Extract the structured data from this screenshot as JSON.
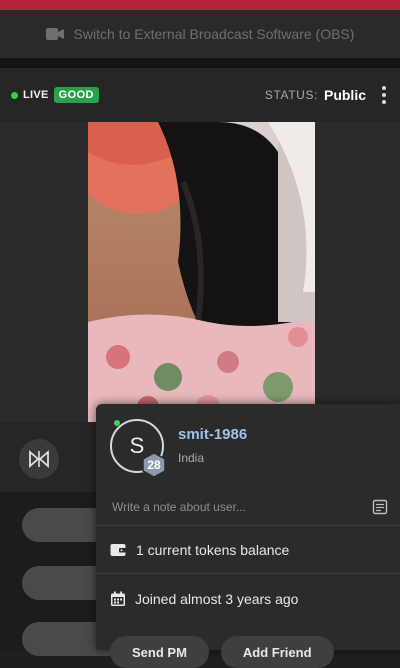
{
  "obs_bar": {
    "label": "Switch to External Broadcast Software (OBS)",
    "icon": "video-camera-icon"
  },
  "status_bar": {
    "live_label": "LIVE",
    "quality_badge": "GOOD",
    "status_label": "STATUS:",
    "status_value": "Public",
    "menu_icon": "kebab-menu-icon"
  },
  "controls": {
    "split_icon": "split-view-icon"
  },
  "user_card": {
    "avatar_initial": "S",
    "level": "28",
    "username": "smit-1986",
    "country": "India",
    "note_placeholder": "Write a note about user...",
    "note_icon": "note-icon",
    "tokens_text": "1 current tokens balance",
    "tokens_icon": "wallet-icon",
    "joined_text": "Joined almost 3 years ago",
    "joined_icon": "calendar-icon",
    "buttons": [
      {
        "label": "Send PM"
      },
      {
        "label": "Add Friend"
      }
    ]
  },
  "colors": {
    "accent_red": "#b3263a",
    "good_green": "#2aa24a",
    "live_dot": "#2fd34a",
    "username_blue": "#9cc3e8",
    "level_badge": "#8a9aac"
  }
}
